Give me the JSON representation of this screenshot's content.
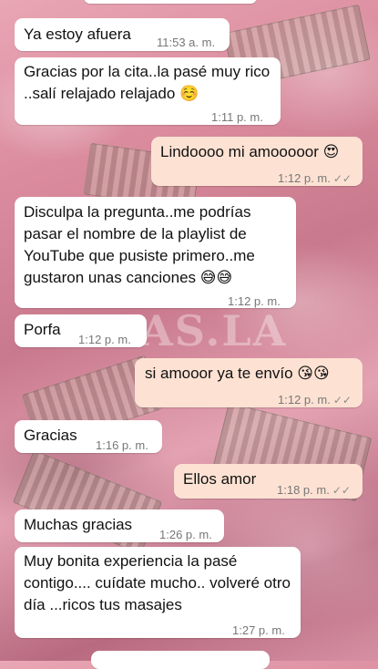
{
  "watermark": "NAS.LA",
  "messages": [
    {
      "text": "Ya estoy afuera",
      "time": "11:53 a. m.",
      "dir": "in"
    },
    {
      "text": "Gracias por la cita..la pasé muy rico ..salí relajado relajado",
      "emoji": "☺️",
      "time": "1:11 p. m.",
      "dir": "in"
    },
    {
      "text": "Lindoooo mi amooooor",
      "emoji": "😍",
      "time": "1:12 p. m.",
      "dir": "out",
      "ticks": "✓✓"
    },
    {
      "text": "Disculpa la pregunta..me podrías pasar el nombre de la playlist de YouTube que pusiste primero..me gustaron unas canciones",
      "emoji": "😅😅",
      "time": "1:12 p. m.",
      "dir": "in"
    },
    {
      "text": "Porfa",
      "time": "1:12 p. m.",
      "dir": "in"
    },
    {
      "text": "si amooor ya te envío",
      "emoji": "😘😘",
      "time": "1:12 p. m.",
      "dir": "out",
      "ticks": "✓✓"
    },
    {
      "text": "Gracias",
      "time": "1:16 p. m.",
      "dir": "in"
    },
    {
      "text": "Ellos amor",
      "time": "1:18 p. m.",
      "dir": "out",
      "ticks": "✓✓"
    },
    {
      "text": "Muchas gracias",
      "time": "1:26 p. m.",
      "dir": "in"
    },
    {
      "text": "Muy bonita experiencia la pasé contigo.... cuídate mucho.. volveré otro día ...ricos tus masajes",
      "time": "1:27 p. m.",
      "dir": "in"
    }
  ]
}
